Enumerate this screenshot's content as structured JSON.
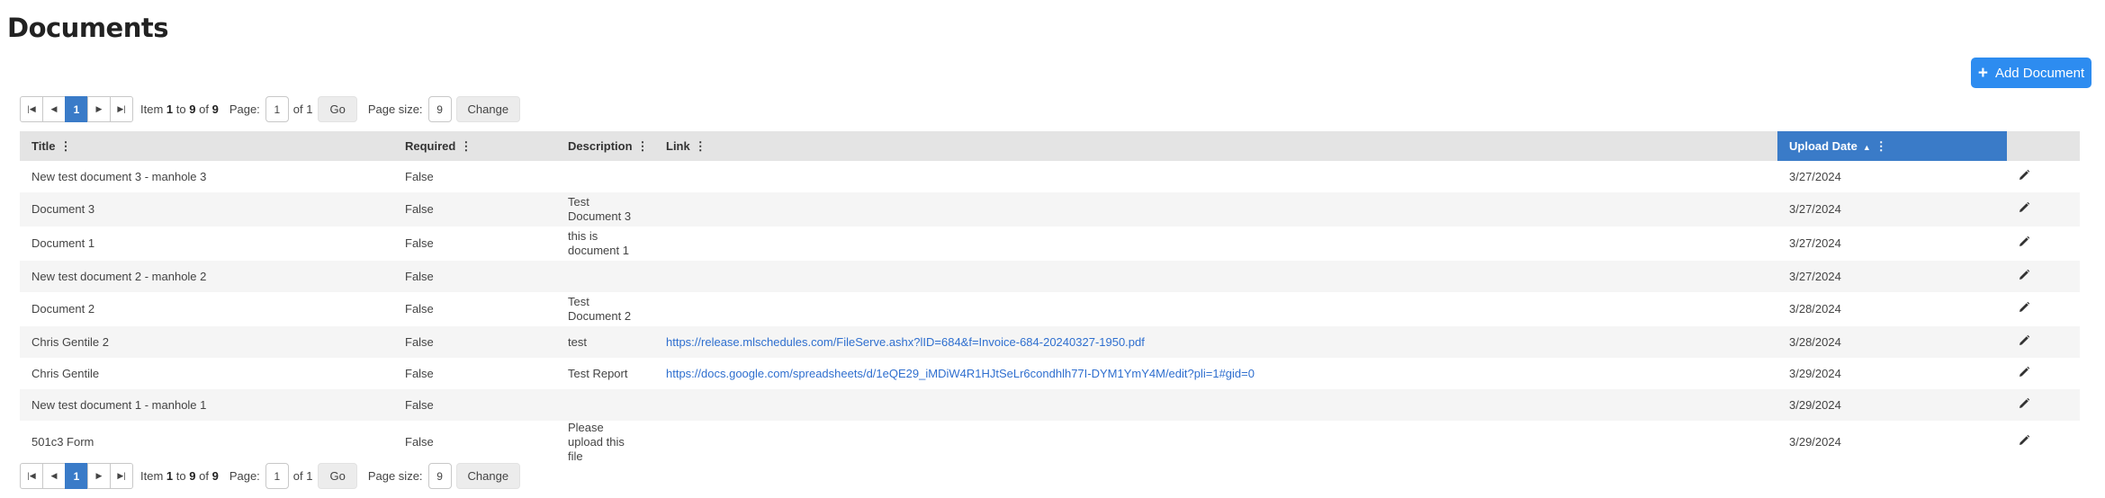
{
  "page": {
    "title": "Documents"
  },
  "actions": {
    "add_document": "Add Document"
  },
  "pager": {
    "current_page": "1",
    "item_word": "Item",
    "item_from": "1",
    "to_word": "to",
    "item_to": "9",
    "of_word": "of",
    "item_total": "9",
    "page_label": "Page:",
    "page_value": "1",
    "of_pages": "of 1",
    "go": "Go",
    "page_size_label": "Page size:",
    "page_size_value": "9",
    "change": "Change"
  },
  "columns": {
    "title": "Title",
    "required": "Required",
    "description": "Description",
    "link": "Link",
    "upload_date": "Upload Date"
  },
  "rows": [
    {
      "title": "New test document 3 - manhole 3",
      "required": "False",
      "description": "",
      "link": "",
      "upload_date": "3/27/2024"
    },
    {
      "title": "Document 3",
      "required": "False",
      "description": "Test Document 3",
      "link": "",
      "upload_date": "3/27/2024"
    },
    {
      "title": "Document 1",
      "required": "False",
      "description": "this is document 1",
      "link": "",
      "upload_date": "3/27/2024"
    },
    {
      "title": "New test document 2 - manhole 2",
      "required": "False",
      "description": "",
      "link": "",
      "upload_date": "3/27/2024"
    },
    {
      "title": "Document 2",
      "required": "False",
      "description": "Test Document 2",
      "link": "",
      "upload_date": "3/28/2024"
    },
    {
      "title": "Chris Gentile 2",
      "required": "False",
      "description": "test",
      "link": "https://release.mlschedules.com/FileServe.ashx?lID=684&f=Invoice-684-20240327-1950.pdf",
      "upload_date": "3/28/2024"
    },
    {
      "title": "Chris Gentile",
      "required": "False",
      "description": "Test Report",
      "link": "https://docs.google.com/spreadsheets/d/1eQE29_iMDiW4R1HJtSeLr6condhlh77I-DYM1YmY4M/edit?pli=1#gid=0",
      "upload_date": "3/29/2024"
    },
    {
      "title": "New test document 1 - manhole 1",
      "required": "False",
      "description": "",
      "link": "",
      "upload_date": "3/29/2024"
    },
    {
      "title": "501c3 Form",
      "required": "False",
      "description": "Please upload this file",
      "link": "",
      "upload_date": "3/29/2024"
    }
  ],
  "icons": {
    "edit": "pencil-icon",
    "add": "plus-icon"
  },
  "colors": {
    "accent": "#2d8cf0",
    "sorted_header": "#3a7bc8",
    "link": "#2f6fcf"
  }
}
